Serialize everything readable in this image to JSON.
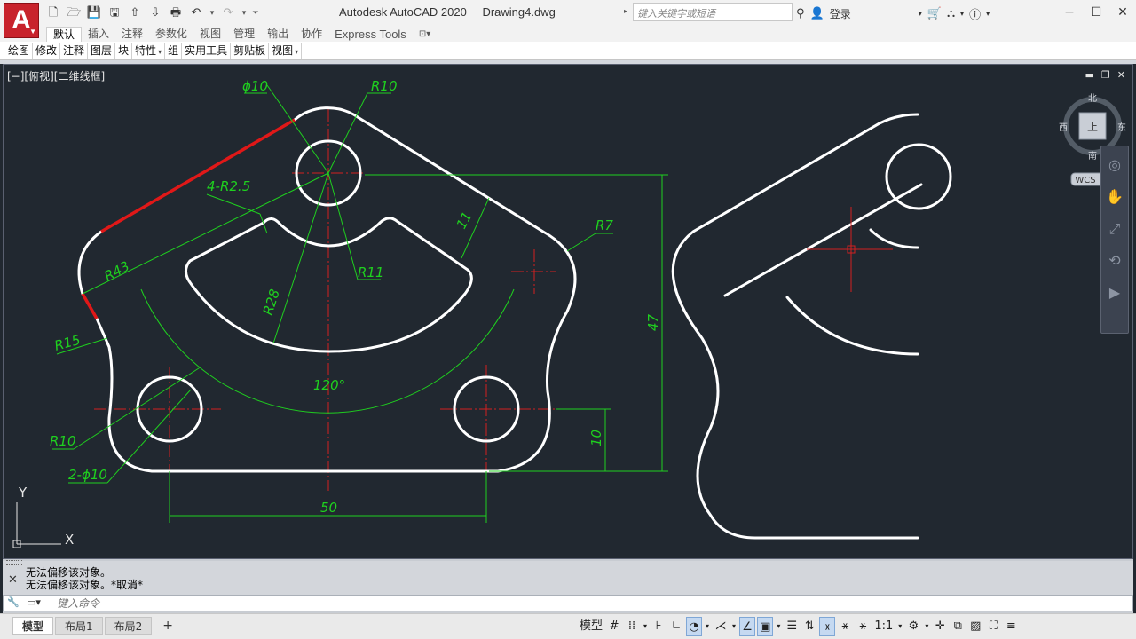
{
  "app": {
    "logo": "A",
    "title": "Autodesk AutoCAD 2020",
    "document": "Drawing4.dwg"
  },
  "search": {
    "placeholder": "键入关键字或短语"
  },
  "account": {
    "login": "登录"
  },
  "ribbon": {
    "tabs": [
      "默认",
      "插入",
      "注释",
      "参数化",
      "视图",
      "管理",
      "输出",
      "协作",
      "Express Tools"
    ],
    "active_tab": "默认",
    "panels": [
      "绘图",
      "修改",
      "注释",
      "图层",
      "块",
      "特性",
      "组",
      "实用工具",
      "剪贴板",
      "视图"
    ]
  },
  "viewport": {
    "label": "[−][俯视][二维线框]",
    "viewcube": {
      "north": "北",
      "south": "南",
      "east": "东",
      "west": "西",
      "face": "上",
      "wcs": "WCS"
    },
    "ucs": {
      "x": "X",
      "y": "Y"
    }
  },
  "dimensions": {
    "d_hole_top": "ϕ10",
    "r_top_arc": "R10",
    "r_fillets": "4-R2.5",
    "r43": "R43",
    "r28": "R28",
    "r11": "R11",
    "slot_width": "11",
    "r7": "R7",
    "r15": "R15",
    "angle": "120°",
    "height_total": "47",
    "height_holes": "10",
    "r10_bottom": "R10",
    "holes_bottom": "2-ϕ10",
    "width_holes": "50"
  },
  "command": {
    "history": [
      "无法偏移该对象。",
      "无法偏移该对象。*取消*"
    ],
    "placeholder": "键入命令"
  },
  "layouts": [
    "模型",
    "布局1",
    "布局2"
  ],
  "active_layout": "模型",
  "status": {
    "model_label": "模型",
    "scale": "1:1"
  },
  "colors": {
    "canvas": "#212830",
    "geometry": "#ffffff",
    "dimension": "#1fd01f",
    "centerline": "#d42020",
    "selected": "#e01818"
  }
}
